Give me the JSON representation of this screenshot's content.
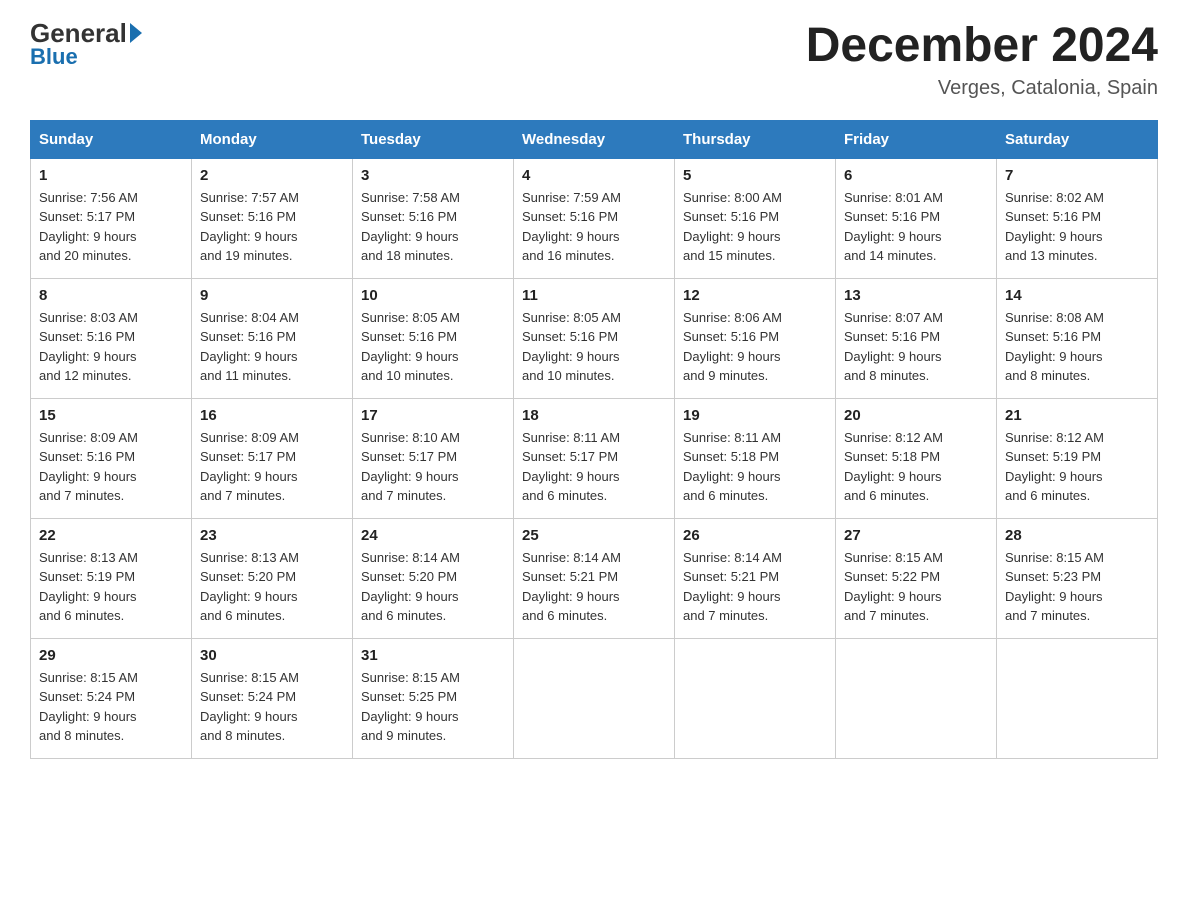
{
  "header": {
    "logo_general": "General",
    "logo_blue": "Blue",
    "month_title": "December 2024",
    "subtitle": "Verges, Catalonia, Spain"
  },
  "columns": [
    "Sunday",
    "Monday",
    "Tuesday",
    "Wednesday",
    "Thursday",
    "Friday",
    "Saturday"
  ],
  "weeks": [
    [
      {
        "day": "1",
        "sunrise": "7:56 AM",
        "sunset": "5:17 PM",
        "daylight": "9 hours and 20 minutes."
      },
      {
        "day": "2",
        "sunrise": "7:57 AM",
        "sunset": "5:16 PM",
        "daylight": "9 hours and 19 minutes."
      },
      {
        "day": "3",
        "sunrise": "7:58 AM",
        "sunset": "5:16 PM",
        "daylight": "9 hours and 18 minutes."
      },
      {
        "day": "4",
        "sunrise": "7:59 AM",
        "sunset": "5:16 PM",
        "daylight": "9 hours and 16 minutes."
      },
      {
        "day": "5",
        "sunrise": "8:00 AM",
        "sunset": "5:16 PM",
        "daylight": "9 hours and 15 minutes."
      },
      {
        "day": "6",
        "sunrise": "8:01 AM",
        "sunset": "5:16 PM",
        "daylight": "9 hours and 14 minutes."
      },
      {
        "day": "7",
        "sunrise": "8:02 AM",
        "sunset": "5:16 PM",
        "daylight": "9 hours and 13 minutes."
      }
    ],
    [
      {
        "day": "8",
        "sunrise": "8:03 AM",
        "sunset": "5:16 PM",
        "daylight": "9 hours and 12 minutes."
      },
      {
        "day": "9",
        "sunrise": "8:04 AM",
        "sunset": "5:16 PM",
        "daylight": "9 hours and 11 minutes."
      },
      {
        "day": "10",
        "sunrise": "8:05 AM",
        "sunset": "5:16 PM",
        "daylight": "9 hours and 10 minutes."
      },
      {
        "day": "11",
        "sunrise": "8:05 AM",
        "sunset": "5:16 PM",
        "daylight": "9 hours and 10 minutes."
      },
      {
        "day": "12",
        "sunrise": "8:06 AM",
        "sunset": "5:16 PM",
        "daylight": "9 hours and 9 minutes."
      },
      {
        "day": "13",
        "sunrise": "8:07 AM",
        "sunset": "5:16 PM",
        "daylight": "9 hours and 8 minutes."
      },
      {
        "day": "14",
        "sunrise": "8:08 AM",
        "sunset": "5:16 PM",
        "daylight": "9 hours and 8 minutes."
      }
    ],
    [
      {
        "day": "15",
        "sunrise": "8:09 AM",
        "sunset": "5:16 PM",
        "daylight": "9 hours and 7 minutes."
      },
      {
        "day": "16",
        "sunrise": "8:09 AM",
        "sunset": "5:17 PM",
        "daylight": "9 hours and 7 minutes."
      },
      {
        "day": "17",
        "sunrise": "8:10 AM",
        "sunset": "5:17 PM",
        "daylight": "9 hours and 7 minutes."
      },
      {
        "day": "18",
        "sunrise": "8:11 AM",
        "sunset": "5:17 PM",
        "daylight": "9 hours and 6 minutes."
      },
      {
        "day": "19",
        "sunrise": "8:11 AM",
        "sunset": "5:18 PM",
        "daylight": "9 hours and 6 minutes."
      },
      {
        "day": "20",
        "sunrise": "8:12 AM",
        "sunset": "5:18 PM",
        "daylight": "9 hours and 6 minutes."
      },
      {
        "day": "21",
        "sunrise": "8:12 AM",
        "sunset": "5:19 PM",
        "daylight": "9 hours and 6 minutes."
      }
    ],
    [
      {
        "day": "22",
        "sunrise": "8:13 AM",
        "sunset": "5:19 PM",
        "daylight": "9 hours and 6 minutes."
      },
      {
        "day": "23",
        "sunrise": "8:13 AM",
        "sunset": "5:20 PM",
        "daylight": "9 hours and 6 minutes."
      },
      {
        "day": "24",
        "sunrise": "8:14 AM",
        "sunset": "5:20 PM",
        "daylight": "9 hours and 6 minutes."
      },
      {
        "day": "25",
        "sunrise": "8:14 AM",
        "sunset": "5:21 PM",
        "daylight": "9 hours and 6 minutes."
      },
      {
        "day": "26",
        "sunrise": "8:14 AM",
        "sunset": "5:21 PM",
        "daylight": "9 hours and 7 minutes."
      },
      {
        "day": "27",
        "sunrise": "8:15 AM",
        "sunset": "5:22 PM",
        "daylight": "9 hours and 7 minutes."
      },
      {
        "day": "28",
        "sunrise": "8:15 AM",
        "sunset": "5:23 PM",
        "daylight": "9 hours and 7 minutes."
      }
    ],
    [
      {
        "day": "29",
        "sunrise": "8:15 AM",
        "sunset": "5:24 PM",
        "daylight": "9 hours and 8 minutes."
      },
      {
        "day": "30",
        "sunrise": "8:15 AM",
        "sunset": "5:24 PM",
        "daylight": "9 hours and 8 minutes."
      },
      {
        "day": "31",
        "sunrise": "8:15 AM",
        "sunset": "5:25 PM",
        "daylight": "9 hours and 9 minutes."
      },
      null,
      null,
      null,
      null
    ]
  ],
  "labels": {
    "sunrise": "Sunrise:",
    "sunset": "Sunset:",
    "daylight": "Daylight:"
  }
}
